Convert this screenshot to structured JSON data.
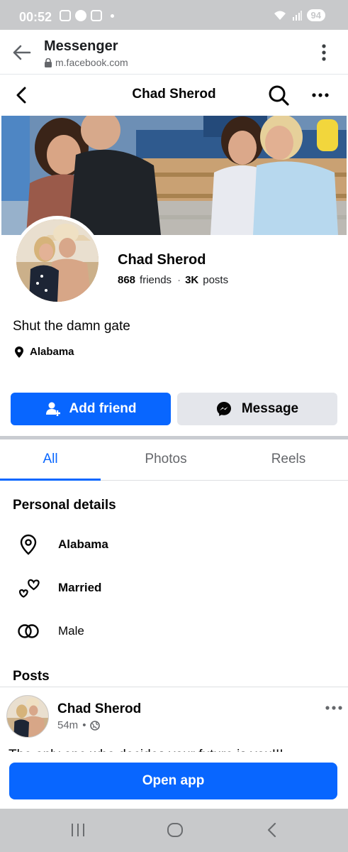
{
  "status_bar": {
    "time": "00:52",
    "battery": "94"
  },
  "browser": {
    "title": "Messenger",
    "url": "m.facebook.com"
  },
  "header": {
    "title": "Chad Sherod"
  },
  "profile": {
    "name": "Chad Sherod",
    "friends_count": "868",
    "friends_label": "friends",
    "separator": "·",
    "posts_count": "3K",
    "posts_label": "posts",
    "bio": "Shut the damn gate",
    "location": "Alabama"
  },
  "actions": {
    "add_friend": "Add friend",
    "message": "Message"
  },
  "tabs": [
    {
      "label": "All",
      "active": true
    },
    {
      "label": "Photos",
      "active": false
    },
    {
      "label": "Reels",
      "active": false
    }
  ],
  "personal_details": {
    "title": "Personal details",
    "items": [
      {
        "icon": "location-pin-icon",
        "label": "Alabama",
        "bold": true
      },
      {
        "icon": "hearts-icon",
        "label": "Married",
        "bold": true
      },
      {
        "icon": "gender-rings-icon",
        "label": "Male",
        "bold": false
      }
    ]
  },
  "posts": {
    "title": "Posts",
    "first_post": {
      "author": "Chad Sherod",
      "time": "54m",
      "audience_icon": "globe-icon",
      "text": "The only one who decides your future is you!!!"
    }
  },
  "open_app": "Open app",
  "colors": {
    "primary": "#0866ff",
    "secondary_button": "#e4e6eb",
    "muted_text": "#65676b",
    "system_bar": "#c8c9cb"
  }
}
